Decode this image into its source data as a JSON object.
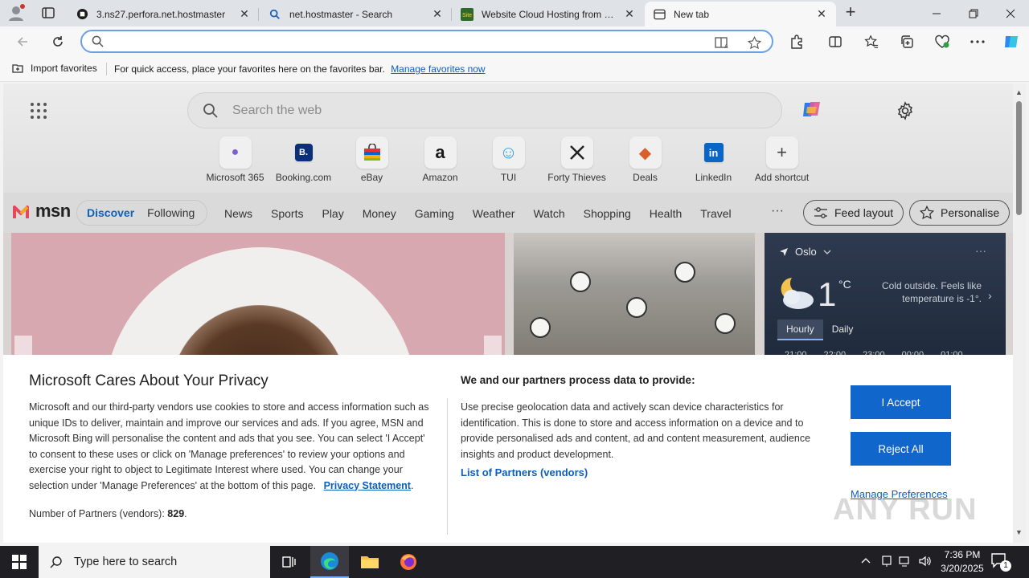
{
  "browser": {
    "tabs": [
      {
        "title": "3.ns27.perfora.net.hostmaster",
        "icon": "document-icon"
      },
      {
        "title": "net.hostmaster - Search",
        "icon": "search-icon"
      },
      {
        "title": "Website Cloud Hosting from SiteGround",
        "icon": "siteground-icon"
      },
      {
        "title": "New tab",
        "icon": "newtab-icon"
      }
    ],
    "address": {
      "value": "",
      "placeholder": ""
    },
    "favorites_bar": {
      "import_label": "Import favorites",
      "message": "For quick access, place your favorites here on the favorites bar.",
      "link": "Manage favorites now"
    }
  },
  "ntp": {
    "search_placeholder": "Search the web",
    "shortcuts": [
      {
        "label": "Microsoft 365",
        "glyph": "●",
        "color": "#7b5cd6"
      },
      {
        "label": "Booking.com",
        "glyph": "B.",
        "color": "#0c2f7a"
      },
      {
        "label": "eBay",
        "glyph": "▤",
        "color": "#333333"
      },
      {
        "label": "Amazon",
        "glyph": "a",
        "color": "#111111"
      },
      {
        "label": "TUI",
        "glyph": "☺",
        "color": "#3aa0e0"
      },
      {
        "label": "Forty Thieves",
        "glyph": "✕",
        "color": "#222222"
      },
      {
        "label": "Deals",
        "glyph": "◆",
        "color": "#d9602b"
      },
      {
        "label": "LinkedIn",
        "glyph": "in",
        "color": "#0a66c2"
      },
      {
        "label": "Add shortcut",
        "glyph": "+",
        "color": "#444444"
      }
    ],
    "msn": {
      "logo": "msn",
      "feed_tabs": [
        "Discover",
        "Following"
      ],
      "categories": [
        "News",
        "Sports",
        "Play",
        "Money",
        "Gaming",
        "Weather",
        "Watch",
        "Shopping",
        "Health",
        "Travel"
      ],
      "more": "···",
      "feed_layout": "Feed layout",
      "personalise": "Personalise"
    },
    "weather": {
      "location": "Oslo",
      "temp": "1",
      "unit": "°C",
      "description": "Cold outside. Feels like temperature is -1°.",
      "tabs": [
        "Hourly",
        "Daily"
      ],
      "hours": [
        "21:00",
        "22:00",
        "23:00",
        "00:00",
        "01:00"
      ]
    }
  },
  "consent": {
    "title": "Microsoft Cares About Your Privacy",
    "body": "Microsoft and our third-party vendors use cookies to store and access information such as unique IDs to deliver, maintain and improve our services and ads. If you agree, MSN and Microsoft Bing will personalise the content and ads that you see. You can select 'I Accept' to consent to these uses or click on 'Manage preferences' to review your options and exercise your right to object to Legitimate Interest where used.  You can change your selection under 'Manage Preferences' at the bottom of this page.",
    "privacy_link": "Privacy Statement",
    "partners_label": "Number of Partners (vendors):",
    "partners_count": "829",
    "purposes_title": "We and our partners process data to provide:",
    "purposes_text": "Use precise geolocation data and actively scan device characteristics for identification. This is done to store and access information on a device and to provide personalised ads and content, ad and content measurement, audience insights and product development.",
    "vendors_link": "List of Partners (vendors)",
    "accept": "I Accept",
    "reject": "Reject All",
    "manage": "Manage Preferences"
  },
  "watermark": "ANY RUN",
  "taskbar": {
    "search_placeholder": "Type here to search",
    "time": "7:36 PM",
    "date": "3/20/2025",
    "notification_count": "1"
  },
  "colors": {
    "accent": "#1166cc",
    "link": "#0b5fbd",
    "taskbar": "#1f1f24"
  }
}
